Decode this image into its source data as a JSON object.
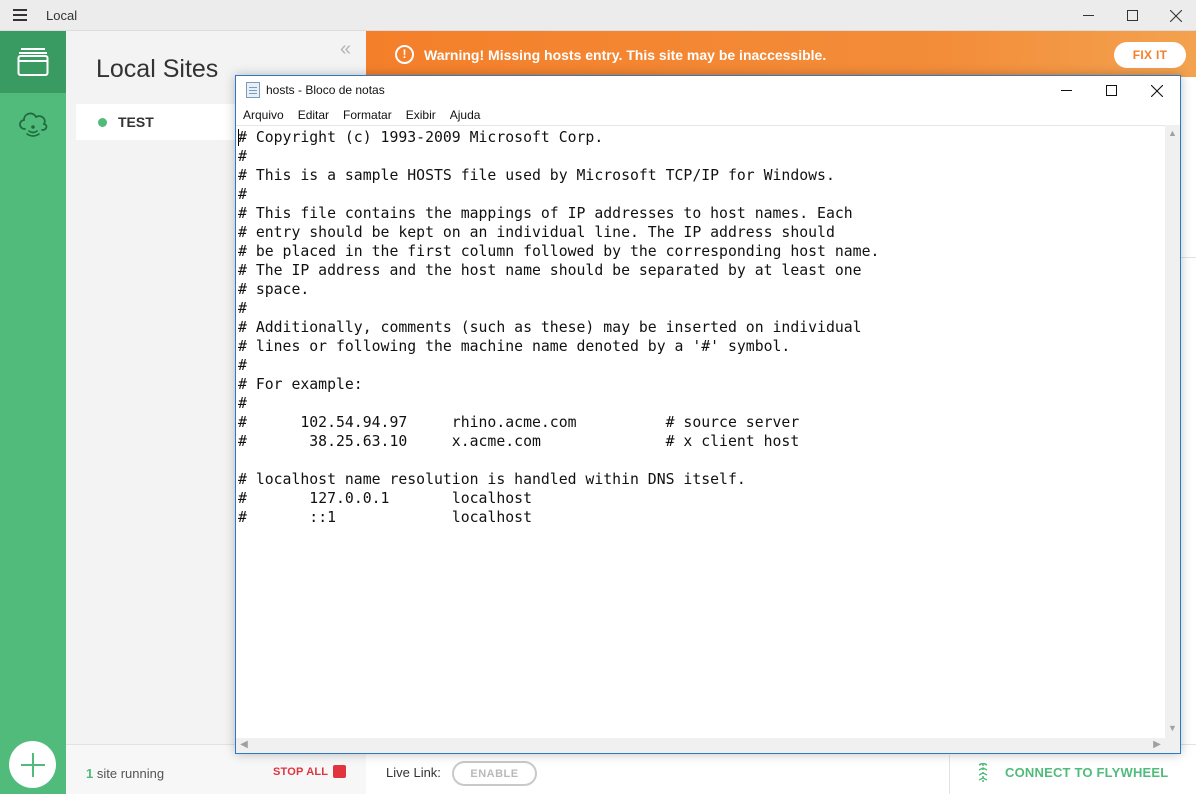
{
  "app": {
    "name": "Local"
  },
  "sidebar": {
    "icons": [
      "sites-icon",
      "cloud-icon",
      "add-icon"
    ]
  },
  "sites_panel": {
    "title": "Local Sites",
    "sites": [
      {
        "name": "TEST",
        "status": "running"
      }
    ]
  },
  "warning": {
    "text": "Warning! Missing hosts entry. This site may be inaccessible.",
    "fix_label": "FIX IT"
  },
  "footer": {
    "running_count": "1",
    "running_suffix": " site running",
    "stop_all_label": "STOP ALL",
    "live_link_label": "Live Link:",
    "enable_label": "ENABLE",
    "connect_label": "CONNECT TO FLYWHEEL"
  },
  "notepad": {
    "title": "hosts - Bloco de notas",
    "menu": [
      "Arquivo",
      "Editar",
      "Formatar",
      "Exibir",
      "Ajuda"
    ],
    "content": "# Copyright (c) 1993-2009 Microsoft Corp.\n#\n# This is a sample HOSTS file used by Microsoft TCP/IP for Windows.\n#\n# This file contains the mappings of IP addresses to host names. Each\n# entry should be kept on an individual line. The IP address should\n# be placed in the first column followed by the corresponding host name.\n# The IP address and the host name should be separated by at least one\n# space.\n#\n# Additionally, comments (such as these) may be inserted on individual\n# lines or following the machine name denoted by a '#' symbol.\n#\n# For example:\n#\n#      102.54.94.97     rhino.acme.com          # source server\n#       38.25.63.10     x.acme.com              # x client host\n\n# localhost name resolution is handled within DNS itself.\n#\t127.0.0.1       localhost\n#\t::1             localhost"
  },
  "colors": {
    "brand_green": "#51bb7b",
    "brand_green_dark": "#3a9b62",
    "warning_orange": "#f47f2a",
    "stop_red": "#e0353e",
    "notepad_border": "#2b79c8"
  }
}
